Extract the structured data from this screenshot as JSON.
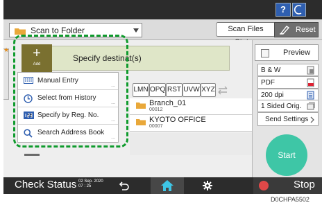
{
  "top_bar": {
    "help_label": "?"
  },
  "header": {
    "app_title": "Scan to Folder",
    "scan_status_label": "Scan Files Status",
    "reset_label": "Reset"
  },
  "destination": {
    "add_label": "Add",
    "specify_text": "Specify destinat(s)"
  },
  "popup_menu": {
    "items": [
      {
        "label": "Manual Entry",
        "icon": "keyboard-icon"
      },
      {
        "label": "Select from History",
        "icon": "history-icon"
      },
      {
        "label": "Specify by Reg. No.",
        "icon": "number-icon"
      },
      {
        "label": "Search Address Book",
        "icon": "search-icon"
      }
    ],
    "more": "..."
  },
  "filter_tabs": [
    "LMN",
    "OPQ",
    "RST",
    "UVW",
    "XYZ"
  ],
  "address_list": [
    {
      "name": "Branch_01",
      "number": "00012"
    },
    {
      "name": "KYOTO OFFICE",
      "number": "00007"
    }
  ],
  "settings": {
    "preview_label": "Preview",
    "color_mode": "B & W",
    "file_type": "PDF",
    "resolution": "200 dpi",
    "sides": "1 Sided Orig.",
    "send_settings_label": "Send Settings"
  },
  "start_label": "Start",
  "bottom_bar": {
    "check_status_label": "Check Status",
    "date": "02 Sep. 2020",
    "time": "07 : 25",
    "stop_label": "Stop"
  },
  "figure_code": "D0CHPA5502",
  "colors": {
    "highlight_dashed": "#0f9b2d",
    "start_button": "#3ec6a6",
    "add_button": "#7a7030",
    "stop": "#e04848"
  }
}
